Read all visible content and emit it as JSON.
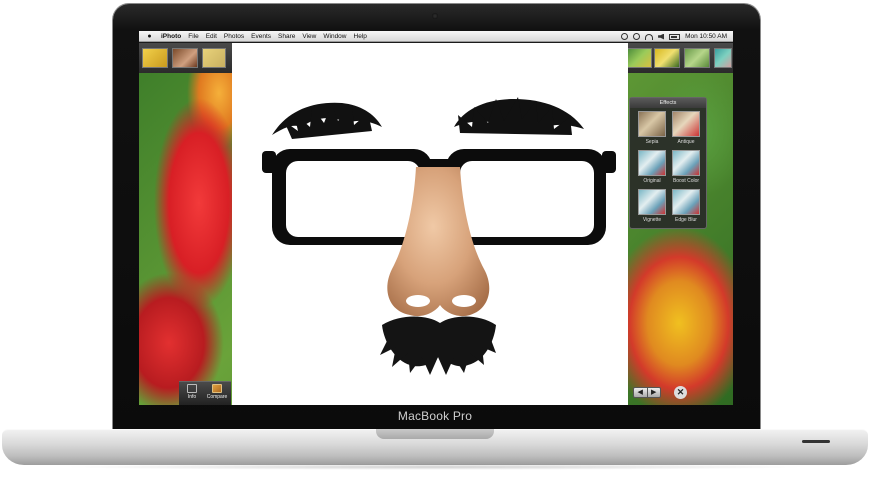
{
  "device": {
    "brand_label": "MacBook Pro"
  },
  "menubar": {
    "apple_icon": "apple-logo-icon",
    "app_name": "iPhoto",
    "menus": [
      "File",
      "Edit",
      "Photos",
      "Events",
      "Share",
      "View",
      "Window",
      "Help"
    ],
    "clock": "Mon 10:50 AM"
  },
  "effects_panel": {
    "title": "Effects",
    "items": [
      {
        "label": "Sepia"
      },
      {
        "label": "Antique"
      },
      {
        "label": "Original"
      },
      {
        "label": "Boost Color"
      },
      {
        "label": "Vignette"
      },
      {
        "label": "Edge Blur"
      }
    ]
  },
  "toolbar": {
    "info_label": "Info",
    "compare_label": "Compare"
  },
  "nav": {
    "prev_icon": "arrow-left-icon",
    "next_icon": "arrow-right-icon",
    "prev_glyph": "◀",
    "next_glyph": "▶",
    "close_glyph": "✕"
  },
  "overlay_image": {
    "subject": "groucho-glasses-disguise"
  }
}
